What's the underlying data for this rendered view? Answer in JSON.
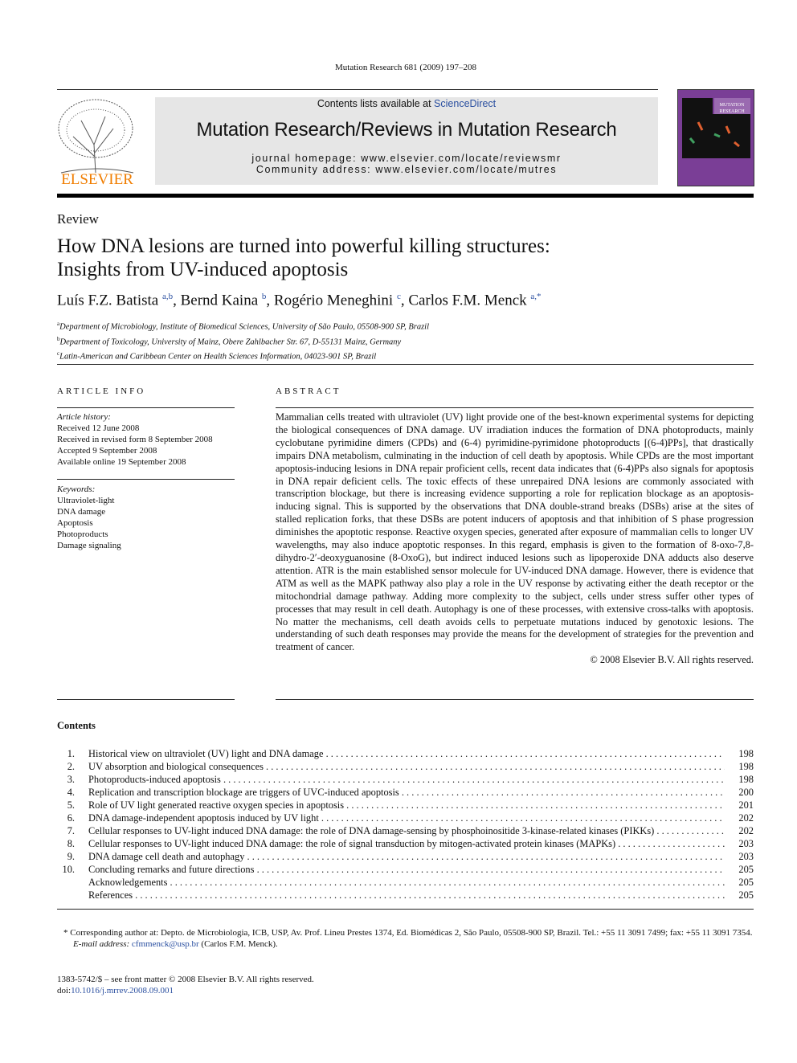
{
  "header": {
    "citation": "Mutation Research 681 (2009) 197–208",
    "contents_prefix": "Contents lists available at ",
    "sciencedirect": "ScienceDirect",
    "journal": "Mutation Research/Reviews in Mutation Research",
    "homepage": "journal homepage: www.elsevier.com/locate/reviewsmr",
    "community": "Community address: www.elsevier.com/locate/mutres",
    "publisher_logo": "ELSEVIER",
    "cover_text": "MUTATION RESEARCH"
  },
  "article": {
    "type": "Review",
    "title_line1": "How DNA lesions are turned into powerful killing structures:",
    "title_line2": "Insights from UV-induced apoptosis",
    "authors": [
      {
        "name": "Luís F.Z. Batista",
        "sup": "a,b"
      },
      {
        "name": "Bernd Kaina",
        "sup": "b"
      },
      {
        "name": "Rogério Meneghini",
        "sup": "c"
      },
      {
        "name": "Carlos F.M. Menck",
        "sup": "a,*"
      }
    ],
    "affiliations": [
      {
        "key": "a",
        "text": "Department of Microbiology, Institute of Biomedical Sciences, University of São Paulo, 05508-900 SP, Brazil"
      },
      {
        "key": "b",
        "text": "Department of Toxicology, University of Mainz, Obere Zahlbacher Str. 67, D-55131 Mainz, Germany"
      },
      {
        "key": "c",
        "text": "Latin-American and Caribbean Center on Health Sciences Information, 04023-901 SP, Brazil"
      }
    ]
  },
  "info": {
    "heading": "ARTICLE INFO",
    "history_label": "Article history:",
    "history": [
      "Received 12 June 2008",
      "Received in revised form 8 September 2008",
      "Accepted 9 September 2008",
      "Available online 19 September 2008"
    ],
    "keywords_label": "Keywords:",
    "keywords": [
      "Ultraviolet-light",
      "DNA damage",
      "Apoptosis",
      "Photoproducts",
      "Damage signaling"
    ]
  },
  "abstract": {
    "heading": "ABSTRACT",
    "text": "Mammalian cells treated with ultraviolet (UV) light provide one of the best-known experimental systems for depicting the biological consequences of DNA damage. UV irradiation induces the formation of DNA photoproducts, mainly cyclobutane pyrimidine dimers (CPDs) and (6-4) pyrimidine-pyrimidone photoproducts [(6-4)PPs], that drastically impairs DNA metabolism, culminating in the induction of cell death by apoptosis. While CPDs are the most important apoptosis-inducing lesions in DNA repair proficient cells, recent data indicates that (6-4)PPs also signals for apoptosis in DNA repair deficient cells. The toxic effects of these unrepaired DNA lesions are commonly associated with transcription blockage, but there is increasing evidence supporting a role for replication blockage as an apoptosis-inducing signal. This is supported by the observations that DNA double-strand breaks (DSBs) arise at the sites of stalled replication forks, that these DSBs are potent inducers of apoptosis and that inhibition of S phase progression diminishes the apoptotic response. Reactive oxygen species, generated after exposure of mammalian cells to longer UV wavelengths, may also induce apoptotic responses. In this regard, emphasis is given to the formation of 8-oxo-7,8-dihydro-2′-deoxyguanosine (8-OxoG), but indirect induced lesions such as lipoperoxide DNA adducts also deserve attention. ATR is the main established sensor molecule for UV-induced DNA damage. However, there is evidence that ATM as well as the MAPK pathway also play a role in the UV response by activating either the death receptor or the mitochondrial damage pathway. Adding more complexity to the subject, cells under stress suffer other types of processes that may result in cell death. Autophagy is one of these processes, with extensive cross-talks with apoptosis. No matter the mechanisms, cell death avoids cells to perpetuate mutations induced by genotoxic lesions. The understanding of such death responses may provide the means for the development of strategies for the prevention and treatment of cancer.",
    "copyright": "© 2008 Elsevier B.V. All rights reserved."
  },
  "contents": {
    "title": "Contents",
    "items": [
      {
        "num": "1.",
        "label": "Historical view on ultraviolet (UV) light and DNA damage",
        "page": "198"
      },
      {
        "num": "2.",
        "label": "UV absorption and biological consequences",
        "page": "198"
      },
      {
        "num": "3.",
        "label": "Photoproducts-induced apoptosis",
        "page": "198"
      },
      {
        "num": "4.",
        "label": "Replication and transcription blockage are triggers of UVC-induced apoptosis",
        "page": "200"
      },
      {
        "num": "5.",
        "label": "Role of UV light generated reactive oxygen species in apoptosis",
        "page": "201"
      },
      {
        "num": "6.",
        "label": "DNA damage-independent apoptosis induced by UV light",
        "page": "202"
      },
      {
        "num": "7.",
        "label": "Cellular responses to UV-light induced DNA damage: the role of DNA damage-sensing by phosphoinositide 3-kinase-related kinases (PIKKs)",
        "page": "202"
      },
      {
        "num": "8.",
        "label": "Cellular responses to UV-light induced DNA damage: the role of signal transduction by mitogen-activated protein kinases (MAPKs)",
        "page": "203"
      },
      {
        "num": "9.",
        "label": "DNA damage cell death and autophagy",
        "page": "203"
      },
      {
        "num": "10.",
        "label": "Concluding remarks and future directions",
        "page": "205"
      },
      {
        "num": "",
        "label": "Acknowledgements",
        "page": "205"
      },
      {
        "num": "",
        "label": "References",
        "page": "205"
      }
    ]
  },
  "footer": {
    "corresponding": "* Corresponding author at: Depto. de Microbiologia, ICB, USP, Av. Prof. Lineu Prestes 1374, Ed. Biomédicas 2, São Paulo, 05508-900 SP, Brazil. Tel.: +55 11 3091 7499; fax: +55 11 3091 7354.",
    "email_label": "E-mail address: ",
    "email": "cfmmenck@usp.br",
    "email_suffix": " (Carlos F.M. Menck).",
    "issn": "1383-5742/$ – see front matter © 2008 Elsevier B.V. All rights reserved.",
    "doi_prefix": "doi:",
    "doi": "10.1016/j.mrrev.2008.09.001"
  },
  "colors": {
    "link": "#2a4fa0",
    "banner": "#e6e6e6",
    "elsevier": "#f07d00",
    "cover": "#7a3e96"
  }
}
